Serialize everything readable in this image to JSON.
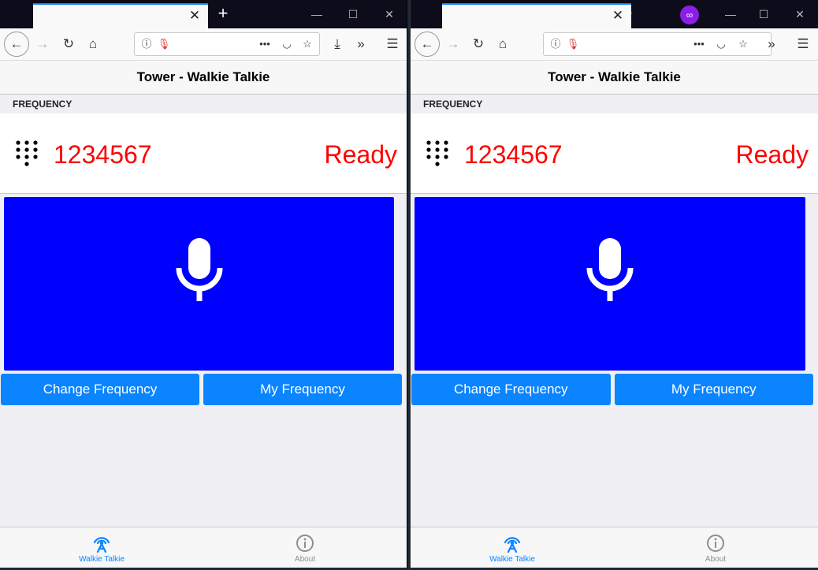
{
  "windows": [
    {
      "id": "left",
      "private": false,
      "app": {
        "title": "Tower - Walkie Talkie",
        "section_header": "FREQUENCY",
        "frequency": "1234567",
        "status": "Ready",
        "buttons": {
          "change_frequency": "Change Frequency",
          "my_frequency": "My Frequency"
        },
        "tabs": [
          {
            "label": "Walkie Talkie",
            "icon": "radio-tower-icon",
            "active": true
          },
          {
            "label": "About",
            "icon": "info-icon",
            "active": false
          }
        ]
      }
    },
    {
      "id": "right",
      "private": true,
      "app": {
        "title": "Tower - Walkie Talkie",
        "section_header": "FREQUENCY",
        "frequency": "1234567",
        "status": "Ready",
        "buttons": {
          "change_frequency": "Change Frequency",
          "my_frequency": "My Frequency"
        },
        "tabs": [
          {
            "label": "Walkie Talkie",
            "icon": "radio-tower-icon",
            "active": true
          },
          {
            "label": "About",
            "icon": "info-icon",
            "active": false
          }
        ]
      }
    }
  ],
  "colors": {
    "accent": "#0a84ff",
    "talk_button": "#0000ff",
    "frequency_text": "#ff0000",
    "status_text": "#ff0000",
    "private_badge": "#8c1ee6"
  },
  "icons": {
    "browser_toolbar": [
      "back-icon",
      "forward-icon",
      "reload-icon",
      "home-icon",
      "info-icon",
      "microphone-icon",
      "more-icon",
      "pocket-icon",
      "star-icon",
      "download-icon",
      "overflow-icon",
      "menu-icon"
    ],
    "window_controls": [
      "minimize-icon",
      "maximize-icon",
      "close-icon"
    ],
    "app": [
      "dialpad-icon",
      "microphone-icon"
    ]
  }
}
